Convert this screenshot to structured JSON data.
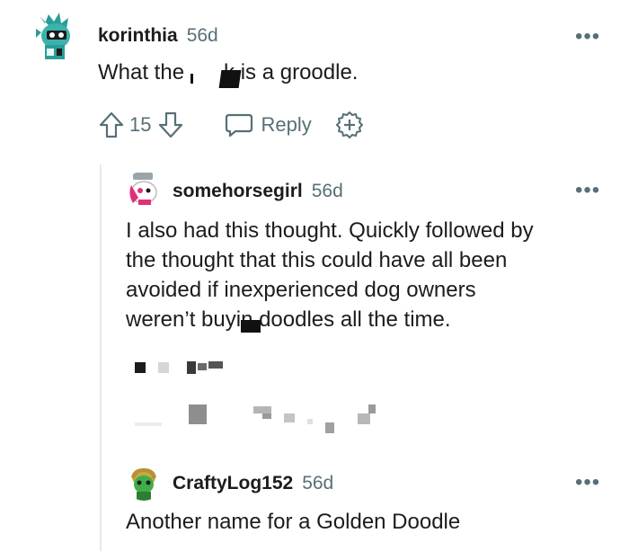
{
  "comments": [
    {
      "username": "korinthia",
      "age": "56d",
      "text_before": "What the",
      "text_after": "k is a groodle.",
      "votes": "15",
      "reply_label": "Reply",
      "menu": "•••"
    },
    {
      "username": "somehorsegirl",
      "age": "56d",
      "lines": [
        "I also had this thought. Quickly followed by",
        "the thought that this could have all been",
        "avoided if inexperienced dog owners",
        "weren’t buyin   doodles all the time."
      ],
      "menu": "•••"
    },
    {
      "username": "CraftyLog152",
      "age": "56d",
      "text": "Another name for a Golden Doodle",
      "menu": "•••"
    }
  ],
  "colors": {
    "text": "#1c1c1c",
    "meta": "#576f76",
    "thread_line": "#e5e9eb"
  }
}
